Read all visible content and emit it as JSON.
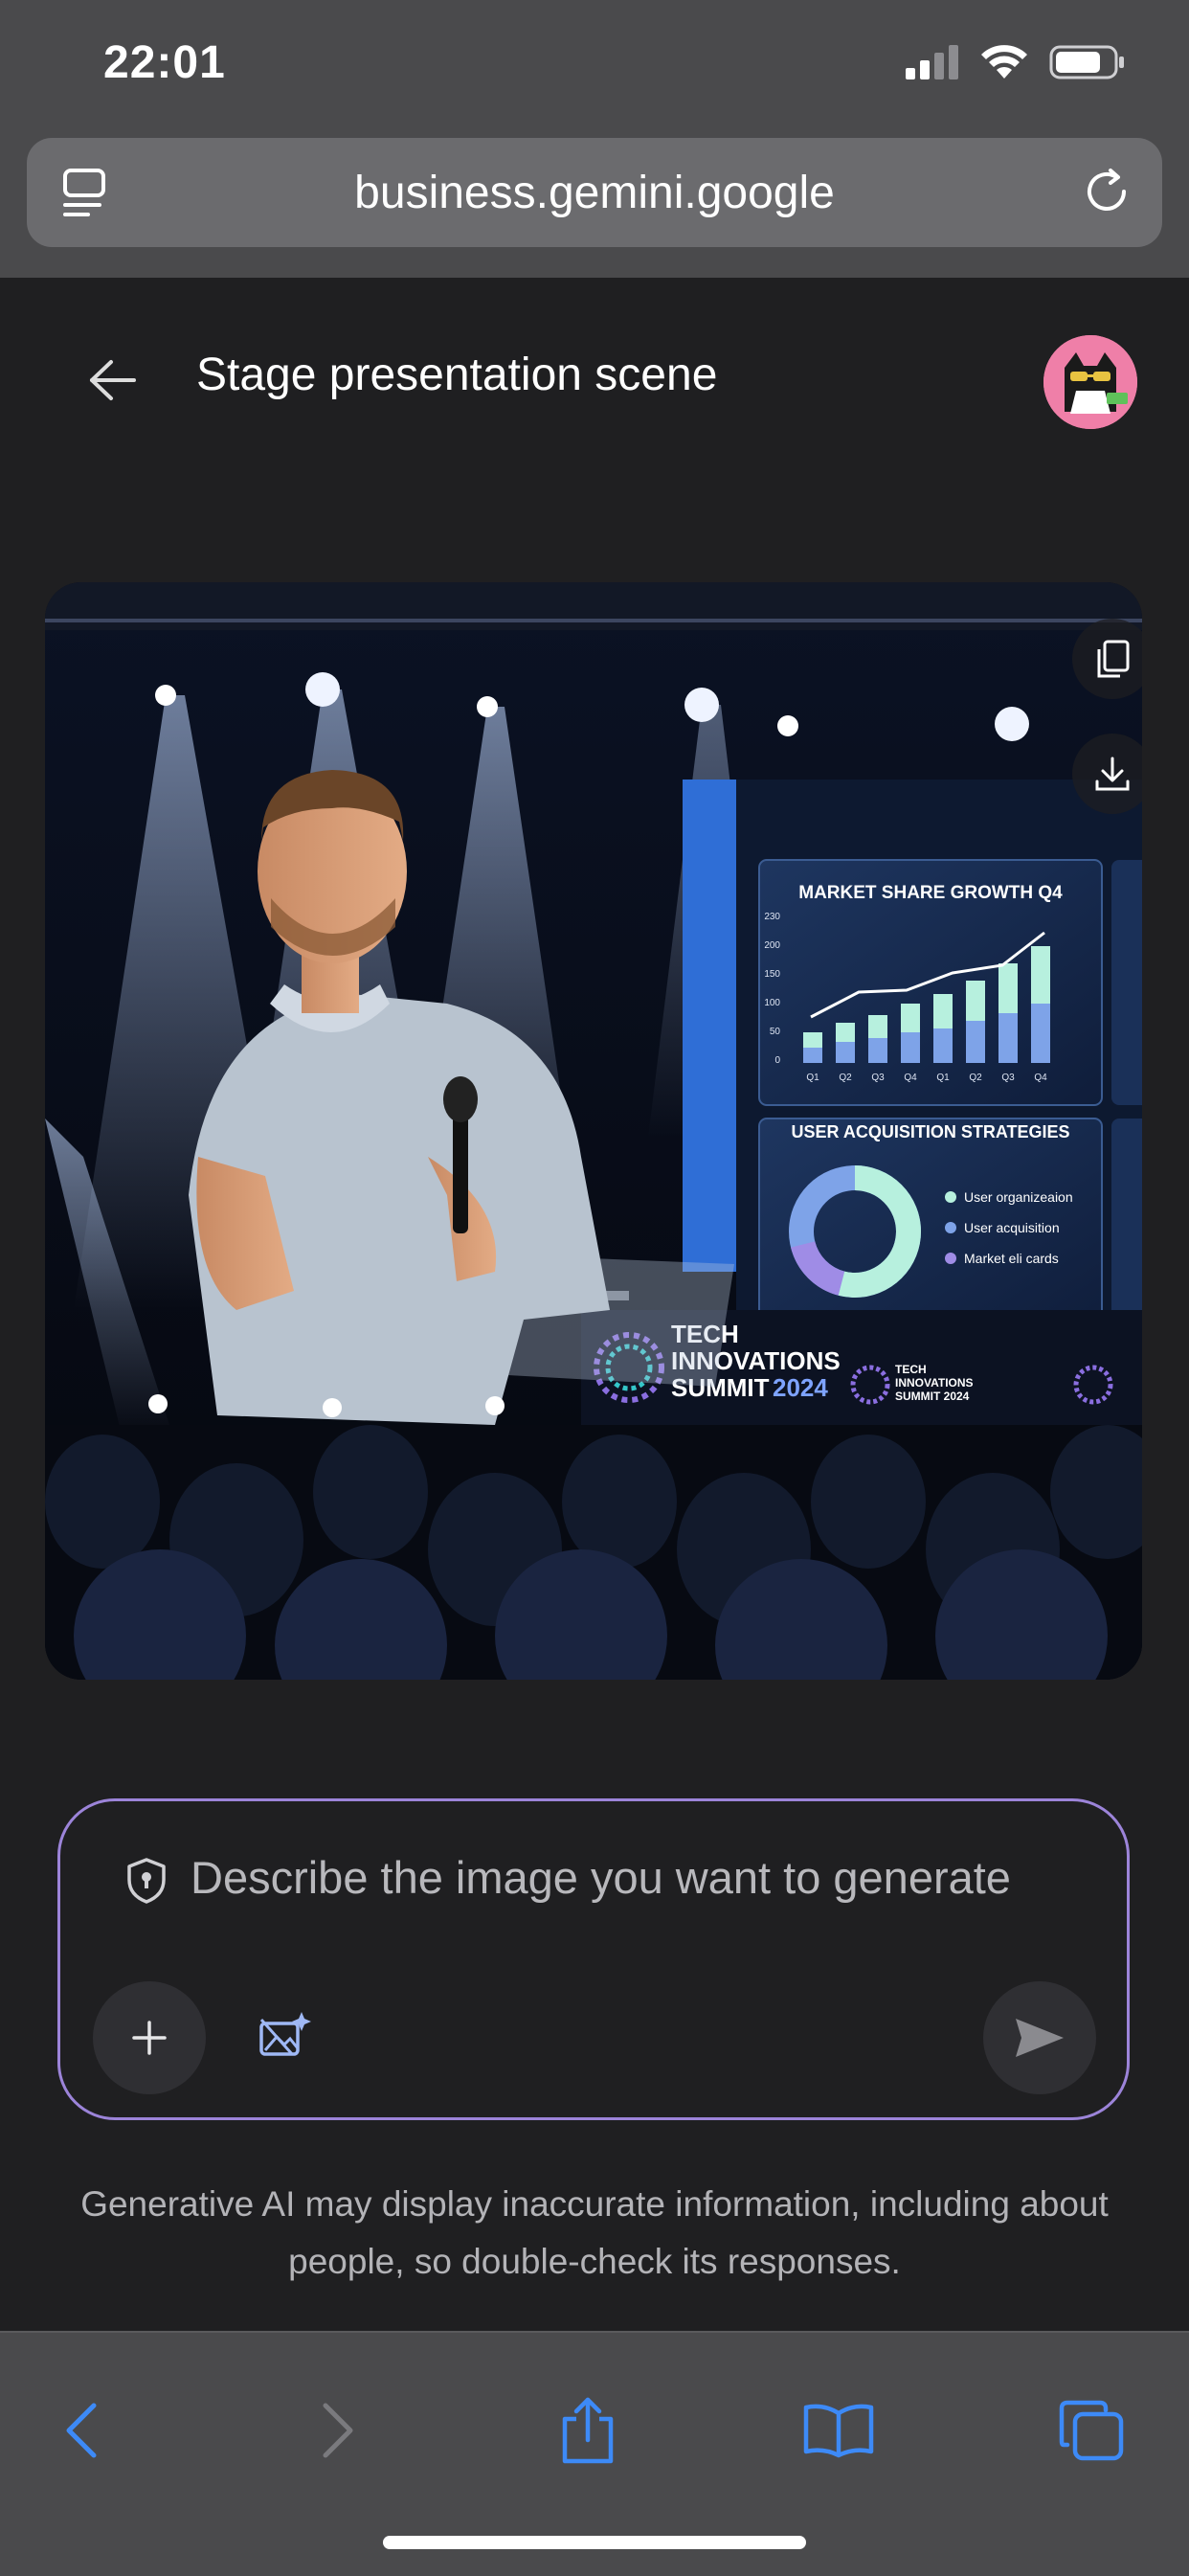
{
  "status_bar": {
    "time": "22:01"
  },
  "browser": {
    "url": "business.gemini.google"
  },
  "header": {
    "title": "Stage presentation scene"
  },
  "image": {
    "chart1_title": "MARKET SHARE GROWTH Q4",
    "chart1_yticks": [
      "230",
      "200",
      "150",
      "100",
      "50",
      "0"
    ],
    "chart1_xticks": [
      "Q1",
      "Q2",
      "Q3",
      "Q4",
      "Q1",
      "Q2",
      "Q3",
      "Q4"
    ],
    "chart2_title": "USER ACQUISITION STRATEGIES",
    "legend": [
      "User organizeaion",
      "User acquisition",
      "Market eli cards"
    ],
    "event_line1": "TECH",
    "event_line2": "INNOVATIONS",
    "event_line3": "SUMMIT",
    "event_year": "2024",
    "small_logo_1": "TECH",
    "small_logo_2": "INNOVATIONS",
    "small_logo_3": "SUMMIT 2024"
  },
  "prompt": {
    "placeholder": "Describe the image you want to generate"
  },
  "disclaimer": "Generative AI may display inaccurate information, including about people, so double-check its responses.",
  "colors": {
    "accent": "#9c84d9",
    "link_blue": "#3d8af7",
    "avatar_bg": "#ef7fa8"
  }
}
